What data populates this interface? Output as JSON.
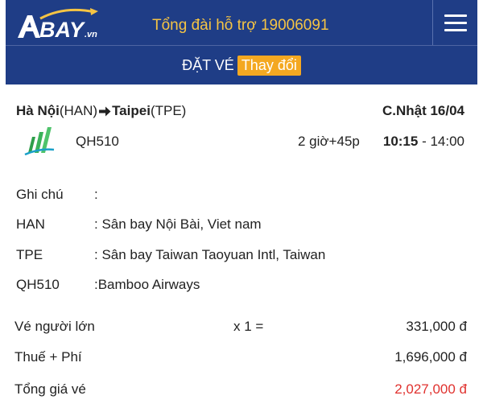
{
  "header": {
    "hotline": "Tổng đài hỗ trợ 19006091",
    "brand_color": "#1f3d86",
    "hotline_color": "#f5c444",
    "menu_icon": "hamburger-icon",
    "logo_icon": "abay-logo-icon"
  },
  "subheader": {
    "title": "ĐẶT VÉ",
    "change_label": "Thay đổi",
    "change_color": "#f4a821"
  },
  "flight": {
    "origin_city": "Hà Nội",
    "origin_code": "(HAN)",
    "destination_city": "Taipei",
    "destination_code": "(TPE)",
    "date": "C.Nhật 16/04",
    "airline_icon": "bamboo-airways-logo-icon",
    "flight_number": "QH510",
    "duration": "2 giờ+45p",
    "depart": "10:15",
    "time_sep": " - ",
    "arrive": "14:00"
  },
  "details": [
    {
      "key": "Ghi chú",
      "value": ":"
    },
    {
      "key": "HAN",
      "value": ": Sân bay Nội Bài, Viet nam"
    },
    {
      "key": "TPE",
      "value": ": Sân bay Taiwan Taoyuan Intl, Taiwan"
    },
    {
      "key": "QH510",
      "value": ":Bamboo Airways"
    }
  ],
  "pricing": {
    "adult_label": "Vé người lớn",
    "adult_qty": "x 1 =",
    "adult_price": "331,000 đ",
    "tax_label": "Thuế + Phí",
    "tax_price": "1,696,000 đ",
    "total_label": "Tổng giá vé",
    "total_price": "2,027,000 đ",
    "total_color": "#e0322f"
  }
}
